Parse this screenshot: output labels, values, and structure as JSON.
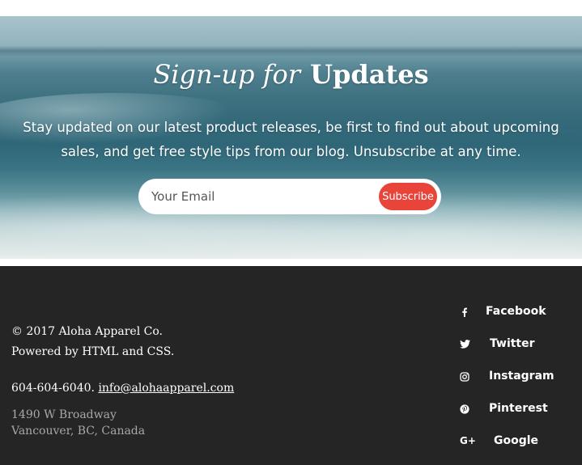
{
  "signup": {
    "title_italic": "Sign-up for",
    "title_bold": "Updates",
    "description": "Stay updated on our latest product releases, be first to find out about upcoming sales, and get free style tips from our blog. Unsubscribe at any time.",
    "email_placeholder": "Your Email",
    "subscribe_label": "Subscribe",
    "accent_color": "#e8443a"
  },
  "footer": {
    "copyright": "© 2017 Aloha Apparel Co.",
    "powered": "Powered by HTML and CSS.",
    "phone": "604-604-6040.",
    "email": "info@alohaapparel.com",
    "address_line1": "1490 W Broadway",
    "address_line2": "Vancouver, BC, Canada",
    "social": [
      {
        "label": "Facebook",
        "icon": "facebook-icon"
      },
      {
        "label": "Twitter",
        "icon": "twitter-icon"
      },
      {
        "label": "Instagram",
        "icon": "instagram-icon"
      },
      {
        "label": "Pinterest",
        "icon": "pinterest-icon"
      },
      {
        "label": "Google",
        "icon": "google-plus-icon"
      }
    ]
  }
}
